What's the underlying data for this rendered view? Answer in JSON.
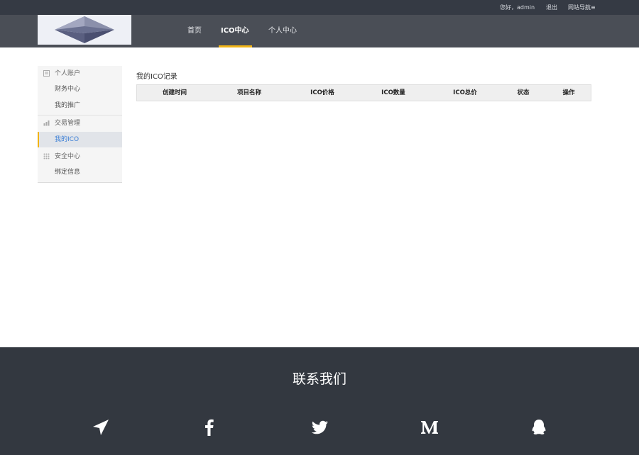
{
  "topbar": {
    "greeting": "您好，admin",
    "logout": "退出",
    "site_nav": "网站导航≡"
  },
  "nav": {
    "items": [
      {
        "label": "首页"
      },
      {
        "label": "ICO中心",
        "active": true
      },
      {
        "label": "个人中心"
      }
    ],
    "accent_color": "#f1b416"
  },
  "sidebar": {
    "groups": [
      {
        "label": "个人账户",
        "icon": "user-account-icon",
        "items": [
          {
            "label": "财务中心"
          },
          {
            "label": "我的推广"
          }
        ]
      },
      {
        "label": "交易管理",
        "icon": "chart-icon",
        "items": [
          {
            "label": "我的ICO",
            "active": true
          }
        ]
      },
      {
        "label": "安全中心",
        "icon": "grid-icon",
        "items": [
          {
            "label": "绑定信息"
          }
        ]
      }
    ]
  },
  "content": {
    "title": "我的ICO记录",
    "table": {
      "columns": [
        "创建时间",
        "项目名称",
        "ICO价格",
        "ICO数量",
        "ICO总价",
        "状态",
        "操作"
      ],
      "rows": []
    }
  },
  "footer": {
    "title": "联系我们",
    "social": [
      {
        "icon": "paper-plane-icon"
      },
      {
        "icon": "facebook-icon"
      },
      {
        "icon": "twitter-icon"
      },
      {
        "icon": "medium-icon"
      },
      {
        "icon": "qq-icon"
      }
    ]
  }
}
